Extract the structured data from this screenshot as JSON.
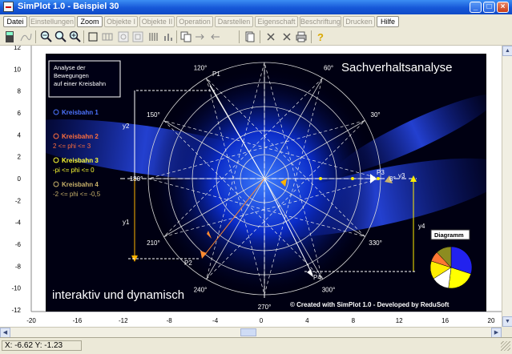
{
  "window": {
    "title": "SimPlot 1.0 - Beispiel 30",
    "min": "_",
    "max": "□",
    "close": "×"
  },
  "menu": {
    "items": [
      "Datei",
      "Einstellungen",
      "Zoom",
      "Objekte I",
      "Objekte II",
      "Operation",
      "Darstellen",
      "Eigenschaft",
      "Beschriftung",
      "Drucken",
      "Hilfe"
    ]
  },
  "axes": {
    "x_ticks": [
      "-20",
      "-16",
      "-12",
      "-8",
      "-4",
      "0",
      "4",
      "8",
      "12",
      "16",
      "20"
    ],
    "y_ticks": [
      "12",
      "10",
      "8",
      "6",
      "4",
      "2",
      "0",
      "-2",
      "-4",
      "-6",
      "-8",
      "-10",
      "-12"
    ]
  },
  "graphic": {
    "title": "Sachverhaltsanalyse",
    "infobox": [
      "Analyse der",
      "Bewegungen",
      "auf einer Kreisbahn"
    ],
    "legend": [
      {
        "name": "Kreisbahn 1",
        "range": "",
        "color": "#4d74ff"
      },
      {
        "name": "Kreisbahn 2",
        "range": "2 <= phi <= 3",
        "color": "#ff6e3c"
      },
      {
        "name": "Kreisbahn 3",
        "range": "-pi <= phi <= 0",
        "color": "#ffff33"
      },
      {
        "name": "Kreisbahn 4",
        "range": "-2 <= phi <= -0,5",
        "color": "#c9b26b"
      }
    ],
    "angles": [
      "0°",
      "30°",
      "60°",
      "90°",
      "120°",
      "150°",
      "180°",
      "210°",
      "240°",
      "270°",
      "300°",
      "330°"
    ],
    "points": [
      "P1",
      "P2",
      "P3",
      "P4"
    ],
    "ylabels": [
      "y1",
      "y2",
      "y3",
      "y4"
    ],
    "slogan": "interaktiv und dynamisch",
    "credit": "© Created with SimPlot 1.0 - Developed by ReduSoft",
    "chart_label": "Diagramm",
    "pie": [
      {
        "value": 30,
        "color": "#2222ee"
      },
      {
        "value": 22,
        "color": "#ffff00"
      },
      {
        "value": 14,
        "color": "#ffffff"
      },
      {
        "value": 14,
        "color": "#ffee00"
      },
      {
        "value": 8,
        "color": "#ff7733"
      },
      {
        "value": 12,
        "color": "#8c8c20"
      }
    ]
  },
  "status": {
    "coords": "X: -6.62    Y: -1.23"
  }
}
